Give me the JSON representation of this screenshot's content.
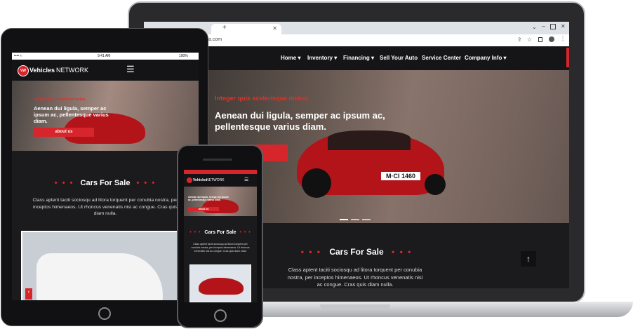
{
  "browser": {
    "new_tab": "+",
    "url_text": "a.com"
  },
  "nav": {
    "items": [
      "Home ▾",
      "Inventory ▾",
      "Financing ▾",
      "Sell Your Auto",
      "Service Center",
      "Company Info ▾"
    ]
  },
  "hero": {
    "eyebrow": "Integer quis scelerisque metus.",
    "title": "Aenean dui ligula, semper ac ipsum ac, pellentesque varius diam.",
    "button": "about us",
    "plate": "M·CI 1460"
  },
  "section": {
    "dots_left": "• • •",
    "dots_right": "• • •",
    "title": "Cars For Sale",
    "text": "Class aptent taciti sociosqu ad litora torquent per conubia nostra, per inceptos himenaeos. Ut rhoncus venenatis nisi ac congue. Cras quis diam nulla."
  },
  "tablet": {
    "carrier": "•••• ≈",
    "time": "9:41 AM",
    "battery": "100%",
    "logo_badge": "VW",
    "logo_brand": "Vehicles",
    "logo_network": "NETWORK"
  },
  "phone": {
    "logo_brand": "Vehicles",
    "logo_network": "NETWORK"
  },
  "colors": {
    "accent": "#d7262b",
    "dark": "#1b1b1d"
  }
}
